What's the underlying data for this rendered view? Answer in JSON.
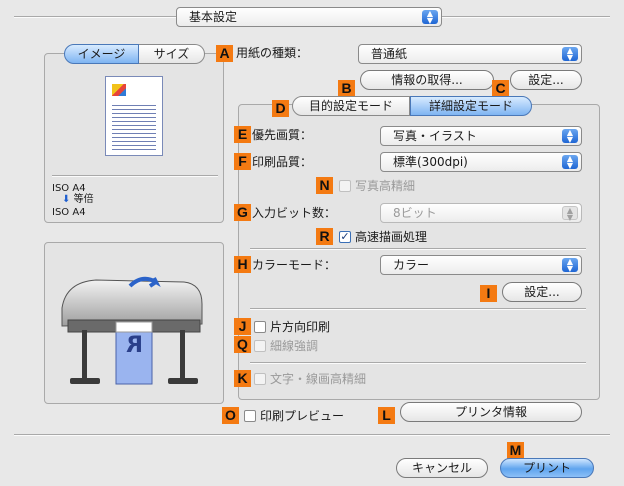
{
  "top_popup": {
    "value": "基本設定"
  },
  "tabs_left": {
    "image": "イメージ",
    "size": "サイズ"
  },
  "paper_type": {
    "label": "用紙の種類：",
    "value": "普通紙"
  },
  "buttons": {
    "get_info": "情報の取得...",
    "settings": "設定...",
    "color_settings": "設定...",
    "printer_info": "プリンタ情報",
    "cancel": "キャンセル",
    "print": "プリント"
  },
  "mode_tabs": {
    "purpose": "目的設定モード",
    "detail": "詳細設定モード"
  },
  "priority": {
    "label": "優先画質：",
    "value": "写真・イラスト"
  },
  "print_quality": {
    "label": "印刷品質：",
    "value": "標準(300dpi)"
  },
  "photo_fine": {
    "label": "写真高精細"
  },
  "input_bits": {
    "label": "入力ビット数：",
    "value": "8ビット"
  },
  "fast_render": {
    "label": "高速描画処理"
  },
  "color_mode": {
    "label": "カラーモード：",
    "value": "カラー"
  },
  "unidirectional": {
    "label": "片方向印刷"
  },
  "thin_line": {
    "label": "細線強調"
  },
  "text_line_fine": {
    "label": "文字・線画高精細"
  },
  "preview": {
    "label": "印刷プレビュー"
  },
  "preview_info": {
    "paper": "ISO A4",
    "scale": "等倍",
    "output": "ISO A4"
  },
  "printer_letter": "R",
  "markers": {
    "a": "A",
    "b": "B",
    "c": "C",
    "d": "D",
    "e": "E",
    "f": "F",
    "g": "G",
    "h": "H",
    "i": "I",
    "j": "J",
    "k": "K",
    "l": "L",
    "m": "M",
    "n": "N",
    "o": "O",
    "q": "Q",
    "r": "R"
  },
  "colors": {
    "marker": "#f47a12",
    "accent_blue": "#1f66d4",
    "background": "#e8e8e8"
  }
}
